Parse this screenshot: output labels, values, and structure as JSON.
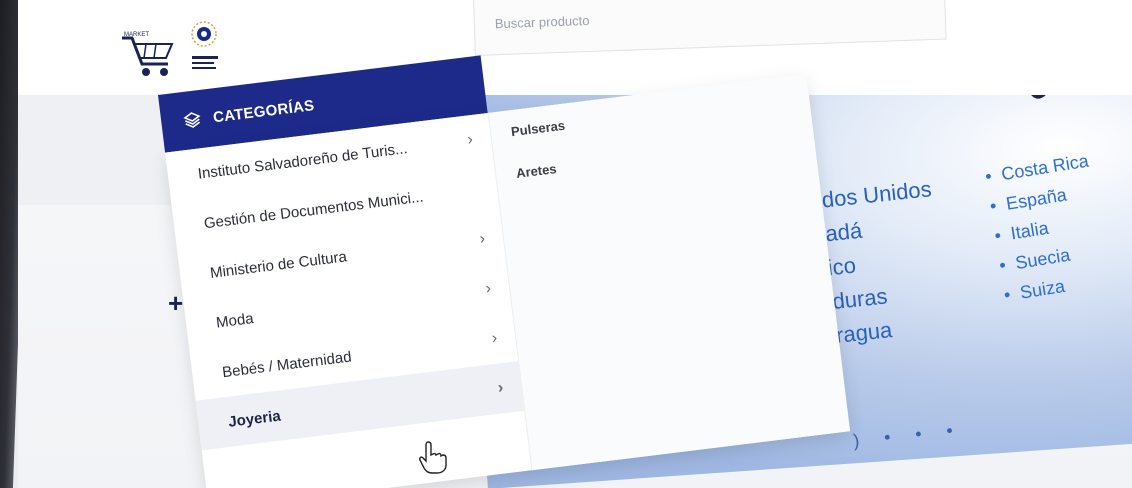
{
  "header": {
    "search_placeholder": "Buscar producto"
  },
  "logo": {
    "market_text": "MARKET"
  },
  "categories": {
    "title": "CATEGORÍAS",
    "items": [
      {
        "label": "Instituto Salvadoreño de Turis..."
      },
      {
        "label": "Gestión de Documentos Munici..."
      },
      {
        "label": "Ministerio de Cultura"
      },
      {
        "label": "Moda"
      },
      {
        "label": "Bebés / Maternidad"
      },
      {
        "label": "Joyeria"
      }
    ],
    "active_index": 5,
    "subcategories": [
      {
        "label": "Pulseras"
      },
      {
        "label": "Aretes"
      }
    ]
  },
  "banner": {
    "countries_left": [
      "ados Unidos",
      "nadá",
      "xico",
      "nduras",
      "aragua"
    ],
    "countries_right": [
      "Costa Rica",
      "España",
      "Italia",
      "Suecia",
      "Suiza"
    ]
  },
  "colors": {
    "category_header_bg": "#1d2a8a",
    "banner_text": "#2a62b8"
  },
  "icons": {
    "category_icon": "layers-icon",
    "chevron": "chevron-right-icon",
    "cursor": "hand-pointer-icon"
  }
}
